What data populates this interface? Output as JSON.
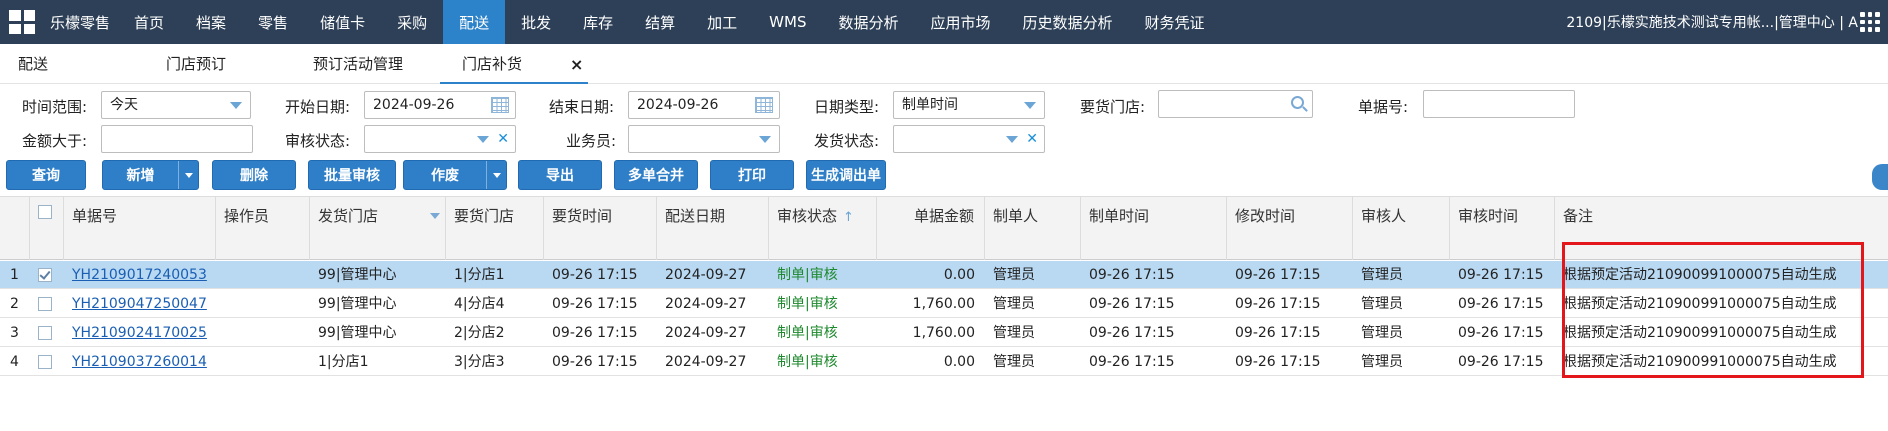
{
  "brand": "乐檬零售",
  "nav": [
    "首页",
    "档案",
    "零售",
    "储值卡",
    "采购",
    "配送",
    "批发",
    "库存",
    "结算",
    "加工",
    "WMS",
    "数据分析",
    "应用市场",
    "历史数据分析",
    "财务凭证"
  ],
  "nav_active": "配送",
  "user_info": "2109|乐檬实施技术测试专用帐...|管理中心 | A",
  "subtabs": [
    "配送",
    "门店预订",
    "预订活动管理",
    "门店补货"
  ],
  "subtab_active": "门店补货",
  "filters": {
    "time_range_label": "时间范围:",
    "time_range_value": "今天",
    "start_date_label": "开始日期:",
    "start_date_value": "2024-09-26",
    "end_date_label": "结束日期:",
    "end_date_value": "2024-09-26",
    "date_type_label": "日期类型:",
    "date_type_value": "制单时间",
    "request_store_label": "要货门店:",
    "request_store_value": "",
    "doc_no_label": "单据号:",
    "doc_no_value": "",
    "amount_gt_label": "金额大于:",
    "amount_gt_value": "",
    "audit_status_label": "审核状态:",
    "audit_status_value": "",
    "salesman_label": "业务员:",
    "salesman_value": "",
    "ship_status_label": "发货状态:",
    "ship_status_value": ""
  },
  "buttons": {
    "query": "查询",
    "add": "新增",
    "delete": "删除",
    "batch_audit": "批量审核",
    "void": "作废",
    "export": "导出",
    "merge": "多单合并",
    "print": "打印",
    "generate": "生成调出单"
  },
  "columns": [
    "单据号",
    "操作员",
    "发货门店",
    "要货门店",
    "要货时间",
    "配送日期",
    "审核状态",
    "单据金额",
    "制单人",
    "制单时间",
    "修改时间",
    "审核人",
    "审核时间",
    "备注"
  ],
  "rows": [
    {
      "idx": "1",
      "checked": true,
      "doc_no": "YH2109017240053",
      "operator": "",
      "ship_store": "99|管理中心",
      "req_store": "1|分店1",
      "req_time": "09-26 17:15",
      "ship_date": "2024-09-27",
      "status": "制单|审核",
      "amount": "0.00",
      "creator": "管理员",
      "create_time": "09-26 17:15",
      "modify_time": "09-26 17:15",
      "auditor": "管理员",
      "audit_time": "09-26 17:15",
      "remark": "根据预定活动210900991000075自动生成"
    },
    {
      "idx": "2",
      "checked": false,
      "doc_no": "YH2109047250047",
      "operator": "",
      "ship_store": "99|管理中心",
      "req_store": "4|分店4",
      "req_time": "09-26 17:15",
      "ship_date": "2024-09-27",
      "status": "制单|审核",
      "amount": "1,760.00",
      "creator": "管理员",
      "create_time": "09-26 17:15",
      "modify_time": "09-26 17:15",
      "auditor": "管理员",
      "audit_time": "09-26 17:15",
      "remark": "根据预定活动210900991000075自动生成"
    },
    {
      "idx": "3",
      "checked": false,
      "doc_no": "YH2109024170025",
      "operator": "",
      "ship_store": "99|管理中心",
      "req_store": "2|分店2",
      "req_time": "09-26 17:15",
      "ship_date": "2024-09-27",
      "status": "制单|审核",
      "amount": "1,760.00",
      "creator": "管理员",
      "create_time": "09-26 17:15",
      "modify_time": "09-26 17:15",
      "auditor": "管理员",
      "audit_time": "09-26 17:15",
      "remark": "根据预定活动210900991000075自动生成"
    },
    {
      "idx": "4",
      "checked": false,
      "doc_no": "YH2109037260014",
      "operator": "",
      "ship_store": "1|分店1",
      "req_store": "3|分店3",
      "req_time": "09-26 17:15",
      "ship_date": "2024-09-27",
      "status": "制单|审核",
      "amount": "0.00",
      "creator": "管理员",
      "create_time": "09-26 17:15",
      "modify_time": "09-26 17:15",
      "auditor": "管理员",
      "audit_time": "09-26 17:15",
      "remark": "根据预定活动210900991000075自动生成"
    }
  ],
  "colors": {
    "topbar": "#2e4057",
    "accent": "#2d83c9",
    "status_green": "#1e8a2e",
    "highlight": "#e3161b"
  }
}
